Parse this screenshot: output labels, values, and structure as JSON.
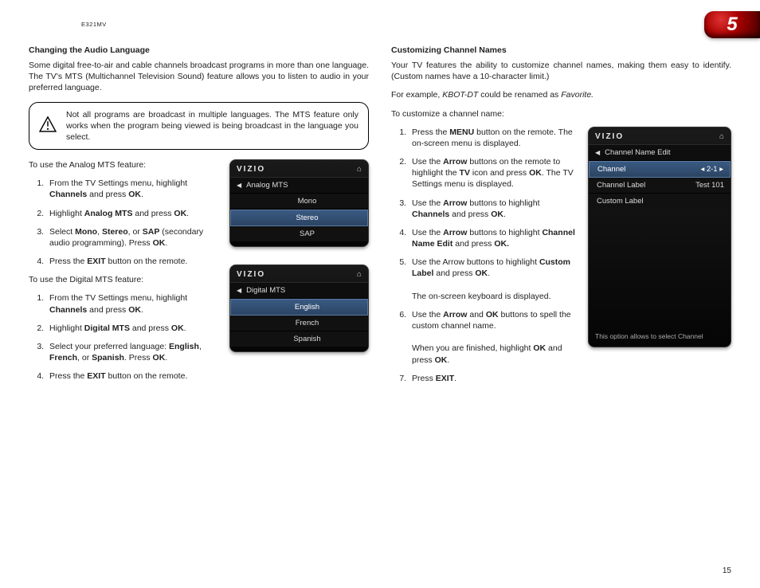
{
  "model": "E321MV",
  "chapter": "5",
  "page_number": "15",
  "left": {
    "heading": "Changing the Audio Language",
    "intro": "Some digital free-to-air and cable channels broadcast programs in more than one language. The TV's MTS (Multichannel Television Sound) feature allows you to listen to audio in your preferred language.",
    "note": "Not all programs are broadcast in multiple languages. The MTS feature only works when the program being viewed is being broadcast in the language you select.",
    "analog_lead": "To use the Analog MTS feature:",
    "analog": {
      "s1a": "From the TV Settings menu, highlight ",
      "s1b": "Channels",
      "s1c": " and press ",
      "s1d": "OK",
      "s1e": ".",
      "s2a": "Highlight ",
      "s2b": "Analog MTS",
      "s2c": " and press ",
      "s2d": "OK",
      "s2e": ".",
      "s3a": "Select ",
      "s3b": "Mono",
      "s3c": ", ",
      "s3d": "Stereo",
      "s3e": ", or ",
      "s3f": "SAP",
      "s3g": " (secondary audio programming). Press ",
      "s3h": "OK",
      "s3i": ".",
      "s4a": "Press the ",
      "s4b": "EXIT",
      "s4c": " button on the remote."
    },
    "digital_lead": "To use the Digital MTS feature:",
    "digital": {
      "s1a": "From the TV Settings menu, highlight ",
      "s1b": "Channels",
      "s1c": " and press ",
      "s1d": "OK",
      "s1e": ".",
      "s2a": "Highlight ",
      "s2b": "Digital MTS",
      "s2c": " and press ",
      "s2d": "OK",
      "s2e": ".",
      "s3a": "Select your preferred language: ",
      "s3b": "English",
      "s3c": ", ",
      "s3d": "French",
      "s3e": ", or ",
      "s3f": "Spanish",
      "s3g": ". Press ",
      "s3h": "OK",
      "s3i": ".",
      "s4a": "Press the ",
      "s4b": "EXIT",
      "s4c": " button on the remote."
    }
  },
  "right": {
    "heading": "Customizing Channel Names",
    "intro": "Your TV features the ability to customize channel names, making them easy to identify. (Custom names have a 10-character limit.)",
    "eg_a": "For example, ",
    "eg_b": "KBOT-DT",
    "eg_c": " could be renamed as ",
    "eg_d": "Favorite.",
    "lead": "To customize a channel name:",
    "steps": {
      "s1a": "Press the ",
      "s1b": "MENU",
      "s1c": " button on the remote. The on-screen menu is displayed.",
      "s2a": "Use the ",
      "s2b": "Arrow",
      "s2c": " buttons on the remote to highlight the ",
      "s2d": "TV",
      "s2e": " icon and press ",
      "s2f": "OK",
      "s2g": ". The TV Settings menu is displayed.",
      "s3a": "Use the ",
      "s3b": "Arrow",
      "s3c": " buttons to highlight ",
      "s3d": "Channels",
      "s3e": " and press ",
      "s3f": "OK",
      "s3g": ".",
      "s4a": "Use the ",
      "s4b": "Arrow",
      "s4c": " buttons to highlight ",
      "s4d": "Channel Name Edit",
      "s4e": " and press ",
      "s4f": "OK.",
      "s5a": "Use the Arrow buttons to highlight ",
      "s5b": "Custom Label",
      "s5c": " and press ",
      "s5d": "OK",
      "s5e": ".",
      "s5f": "The on-screen keyboard is displayed.",
      "s6a": "Use the ",
      "s6b": "Arrow",
      "s6c": " and ",
      "s6d": "OK",
      "s6e": " buttons to spell the custom channel name.",
      "s6f": "When you are finished, highlight ",
      "s6g": "OK",
      "s6h": " and press ",
      "s6i": "OK",
      "s6j": ".",
      "s7a": "Press ",
      "s7b": "EXIT",
      "s7c": "."
    }
  },
  "osd": {
    "brand": "VIZIO",
    "home": "⌂",
    "analog": {
      "title": "Analog MTS",
      "o1": "Mono",
      "o2": "Stereo",
      "o3": "SAP"
    },
    "digital": {
      "title": "Digital MTS",
      "o1": "English",
      "o2": "French",
      "o3": "Spanish"
    },
    "edit": {
      "title": "Channel Name Edit",
      "r1k": "Channel",
      "r1v": "◂ 2-1 ▸",
      "r2k": "Channel Label",
      "r2v": "Test 101",
      "r3k": "Custom Label",
      "help": "This option allows to select Channel"
    }
  }
}
